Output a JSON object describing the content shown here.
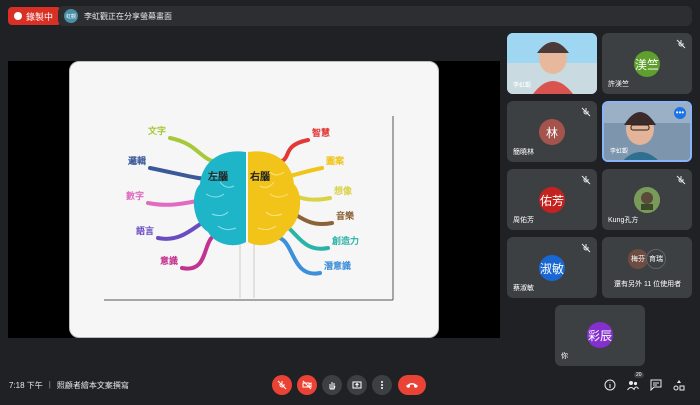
{
  "top": {
    "recording_label": "錄製中",
    "presenter_avatar_text": "虹觀",
    "presenting_text": "李虹觀正在分享螢幕畫面"
  },
  "slide": {
    "left_brain_label": "左腦",
    "right_brain_label": "右腦",
    "left_branches": [
      "文字",
      "邏輯",
      "數字",
      "語言",
      "意識"
    ],
    "right_branches": [
      "智慧",
      "圖案",
      "想像",
      "音樂",
      "創造力",
      "潛意識"
    ],
    "left_colors": [
      "#a6c93a",
      "#3b5998",
      "#e06bbf",
      "#6a4cc2",
      "#c2328f"
    ],
    "right_colors": [
      "#e23838",
      "#f0c419",
      "#d9d247",
      "#8c6239",
      "#2bb3a8",
      "#3d8fd9"
    ]
  },
  "participants": [
    {
      "name": "李虹觀",
      "avatar": "",
      "avatar_color": "",
      "has_video": true
    },
    {
      "name": "許渼竺",
      "avatar": "渼竺",
      "avatar_color": "#5f9f2d",
      "has_video": false
    },
    {
      "name": "簡曉林",
      "avatar": "林",
      "avatar_color": "#a4544d",
      "has_video": false
    },
    {
      "name": "李虹觀",
      "avatar": "",
      "avatar_color": "",
      "has_video": true
    },
    {
      "name": "周佑芳",
      "avatar": "佑芳",
      "avatar_color": "#c5221f",
      "has_video": false
    },
    {
      "name": "Kung孔方",
      "avatar": "",
      "avatar_color": "#6a8a4a",
      "has_video": false
    },
    {
      "name": "蔡淑敏",
      "avatar": "淑敏",
      "avatar_color": "#1967d2",
      "has_video": false
    },
    {
      "name": "還有另外 11 位使用者",
      "avatar": "",
      "avatar_color": "",
      "has_video": false
    },
    {
      "name": "你",
      "avatar": "彩辰",
      "avatar_color": "#8430ce",
      "has_video": false
    }
  ],
  "others": {
    "first": {
      "text": "梅芬",
      "color": "#6d4c41"
    },
    "second": {
      "text": "育瑞",
      "color": "#3c4043"
    }
  },
  "bottom": {
    "time": "7:18 下午",
    "separator": "|",
    "meeting_title": "照顧者繪本文案撰寫",
    "participants_count": "20"
  },
  "colors": {
    "red": "#ea4335",
    "recording": "#d93025",
    "active_border": "#8ab4f8"
  }
}
